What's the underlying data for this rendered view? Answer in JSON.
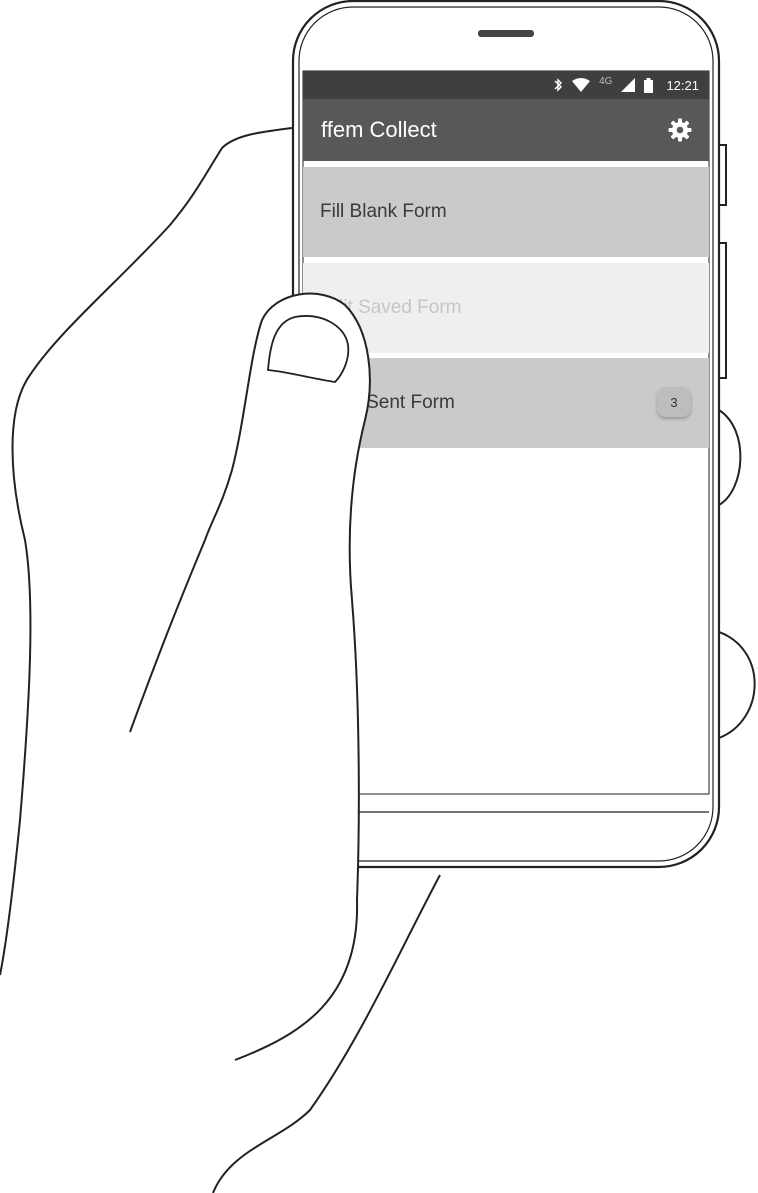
{
  "status_bar": {
    "network": "4G",
    "time": "12:21",
    "icons": [
      "bluetooth-icon",
      "wifi-icon",
      "signal-icon",
      "battery-icon"
    ]
  },
  "app_bar": {
    "title": "ffem Collect",
    "settings_icon": "gear-icon"
  },
  "menu": {
    "items": [
      {
        "label": "Fill Blank Form",
        "enabled": true
      },
      {
        "label": "Edit Saved Form",
        "enabled": false
      },
      {
        "label": "View Sent Form",
        "enabled": true,
        "badge": "3"
      }
    ]
  },
  "colors": {
    "status_bar": "#3f3f3f",
    "app_bar": "#585858",
    "item_enabled": "#cacaca",
    "item_disabled": "#efefef",
    "text_disabled": "#c6c6c6"
  }
}
